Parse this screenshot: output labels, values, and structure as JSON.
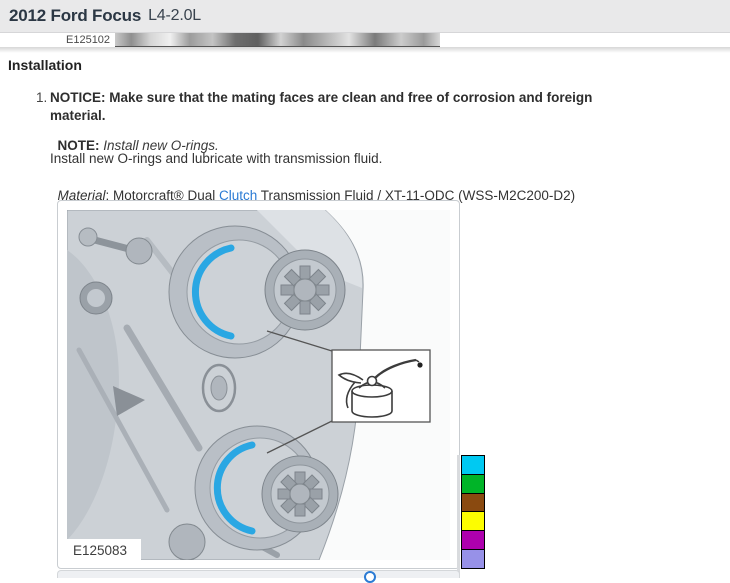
{
  "header": {
    "vehicle": "2012 Ford Focus",
    "engine": "L4-2.0L"
  },
  "previous_figure": {
    "label": "E125102"
  },
  "installation": {
    "heading": "Installation",
    "steps": [
      {
        "number": "1.",
        "notice": "NOTICE: Make sure that the mating faces are clean and free of corrosion and foreign material.",
        "note_label": "NOTE:",
        "note_text": " Install new O-rings.",
        "instruction": "Install new O-rings and lubricate with transmission fluid.",
        "material_label": "Material",
        "material_before_link": ": Motorcraft® Dual ",
        "material_link": "Clutch",
        "material_after_link": " Transmission Fluid / XT-11-QDC (WSS-M2C200-D2)"
      }
    ]
  },
  "figure": {
    "label": "E125083"
  },
  "palette": {
    "colors": [
      "#00c9f2",
      "#00b428",
      "#8a4a10",
      "#fdfd00",
      "#ae00ae",
      "#9791e8"
    ]
  },
  "colors": {
    "link_blue": "#2b7bd4",
    "oring_blue": "#2aa7e3",
    "header_bg": "#e9e9ea",
    "header_text": "#2b3744"
  }
}
